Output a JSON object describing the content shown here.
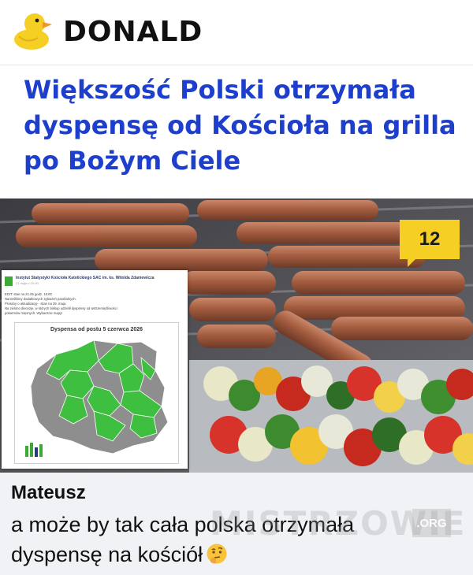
{
  "header": {
    "brand": "DONALD",
    "logo_icon": "rubber-duck-icon",
    "colors": {
      "duck": "#f5cf24",
      "beak": "#f0962a"
    }
  },
  "article": {
    "headline_lines": [
      "Większość Polski otrzymała",
      "dyspensę od Kościoła na grilla",
      "po Bożym Ciele"
    ],
    "headline_color": "#1d3fcc",
    "comment_count": "12",
    "comment_badge_color": "#f5cf24"
  },
  "embedded_post": {
    "org_name": "Instytut Statystyki Kościoła Katolickiego SAC im. ks. Witolda Zdaniewicza",
    "meta": "21 maja o 10:00",
    "lines": [
      "EDIT: stan na 21.05 godz. 15:00",
      "Nanieśliśmy dodatkowych zgłoszeń parafialnych.",
      "Prosimy o aktualizację - Stan na 29. maja.",
      "Na zielono diecezje, w których biskup udzielił dyspensy od wstrzemięźliwości ",
      "pokarmów mięsnych. Wybaczcie mapy!"
    ],
    "map_title": "Dyspensa od postu 5 czerwca 2026",
    "map_colors": {
      "dispensation": "#3fbf3f",
      "none": "#8e8e8e"
    },
    "logo_icon": "iskk-logo-icon"
  },
  "comment": {
    "author": "Mateusz",
    "text_lines": [
      "a może by tak cała polska otrzymała",
      "dyspensę na kościół"
    ],
    "emoji_icon": "thinking-face-emoji"
  },
  "watermark": {
    "text": "MISTRZOWIE",
    "suffix": ".ORG"
  }
}
